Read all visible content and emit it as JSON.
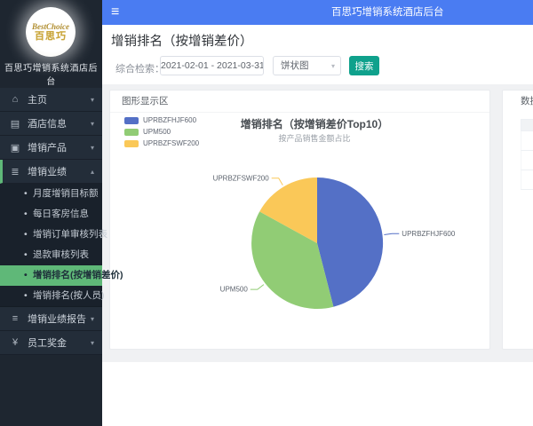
{
  "topbar": {
    "title": "百思巧增销系统酒店后台",
    "hamburger_icon": "≡"
  },
  "sidebar": {
    "logo": {
      "brand": "BestChoice",
      "brand_cn": "百思巧"
    },
    "app_title": "百思巧增销系统酒店后台",
    "menu": [
      {
        "label": "主页",
        "icon": "⌂",
        "chevron": "▾"
      },
      {
        "label": "酒店信息",
        "icon": "▤",
        "chevron": "▾"
      },
      {
        "label": "增销产品",
        "icon": "▣",
        "chevron": "▾"
      },
      {
        "label": "增销业绩",
        "icon": "≣",
        "chevron": "▴"
      },
      {
        "label": "增销业绩报告",
        "icon": "≡",
        "chevron": "▾"
      },
      {
        "label": "员工奖金",
        "icon": "¥",
        "chevron": "▾"
      }
    ],
    "submenu": [
      {
        "label": "月度增销目标额"
      },
      {
        "label": "每日客房信息"
      },
      {
        "label": "增销订单审核列表"
      },
      {
        "label": "退款审核列表"
      },
      {
        "label": "增销排名(按增销差价)",
        "active": true
      },
      {
        "label": "增销排名(按人员)"
      }
    ]
  },
  "page": {
    "title": "增销排名（按增销差价）"
  },
  "filter": {
    "label": "综合检索：",
    "date_range": "2021-02-01 - 2021-03-31",
    "chart_type": "饼状图",
    "select_chevron": "▾",
    "search_label": "搜索"
  },
  "panels": {
    "chart_panel_title": "图形显示区",
    "data_panel_title": "数据显示区"
  },
  "chart_data": {
    "type": "pie",
    "title": "增销排名（按增销差价Top10）",
    "subtitle": "按产品销售金额占比",
    "labels": [
      "UPRBZFHJF600",
      "UPM500",
      "UPRBZFSWF200"
    ],
    "values_pct_estimated": [
      46,
      37,
      17
    ],
    "colors": [
      "#5470c6",
      "#91cc75",
      "#fac858"
    ],
    "legend_position": "top-left",
    "start_angle": "top-clockwise"
  }
}
